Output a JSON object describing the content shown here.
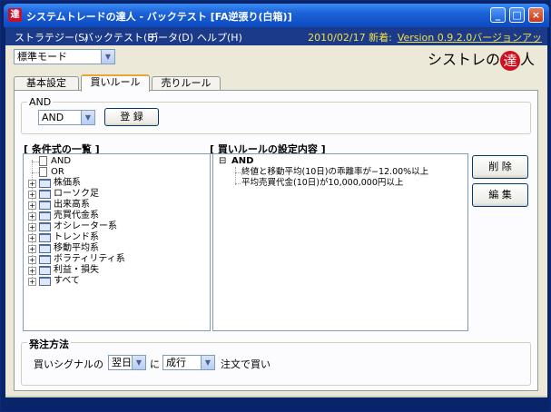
{
  "window": {
    "app_icon_glyph": "達",
    "title": "システムトレードの達人 - バックテスト [FA逆張り(白箱)]",
    "min_glyph": "_",
    "max_glyph": "□",
    "close_glyph": "×"
  },
  "menubar": {
    "items": [
      "ストラテジー(S)",
      "バックテスト(B)",
      "データ(D)",
      "ヘルプ(H)"
    ],
    "date_status": "2010/02/17 新着:",
    "version_link": "Version 0.9.2.0バージョンアッ"
  },
  "mode_select": {
    "value": "標準モード"
  },
  "logo": {
    "text_before": "シストレの",
    "seal": "達",
    "text_after": "人"
  },
  "tabs": [
    "基本設定",
    "買いルール",
    "売りルール"
  ],
  "active_tab": 1,
  "and_group": {
    "label": "AND",
    "select_value": "AND",
    "register_button": "登 録"
  },
  "conditions": {
    "title": "[ 条件式の一覧 ]",
    "items": [
      {
        "label": "AND",
        "type": "doc"
      },
      {
        "label": "OR",
        "type": "doc"
      },
      {
        "label": "株価系",
        "type": "folder"
      },
      {
        "label": "ローソク足",
        "type": "folder"
      },
      {
        "label": "出来高系",
        "type": "folder"
      },
      {
        "label": "売買代金系",
        "type": "folder"
      },
      {
        "label": "オシレーター系",
        "type": "folder"
      },
      {
        "label": "トレンド系",
        "type": "folder"
      },
      {
        "label": "移動平均系",
        "type": "folder"
      },
      {
        "label": "ボラティリティ系",
        "type": "folder"
      },
      {
        "label": "利益・損失",
        "type": "folder"
      },
      {
        "label": "すべて",
        "type": "folder"
      }
    ]
  },
  "rules": {
    "title": "[ 買いルールの設定内容 ]",
    "root_expander": "⊟",
    "root": "AND",
    "items": [
      "終値と移動平均(10日)の乖離率が−12.00%以上",
      "平均売買代金(10日)が10,000,000円以上"
    ]
  },
  "buttons": {
    "delete": "削 除",
    "edit": "編 集"
  },
  "order_group": {
    "label": "発注方法",
    "prefix": "買いシグナルの",
    "day_value": "翌日",
    "connector": "に",
    "type_value": "成行",
    "suffix": "注文で買い"
  }
}
